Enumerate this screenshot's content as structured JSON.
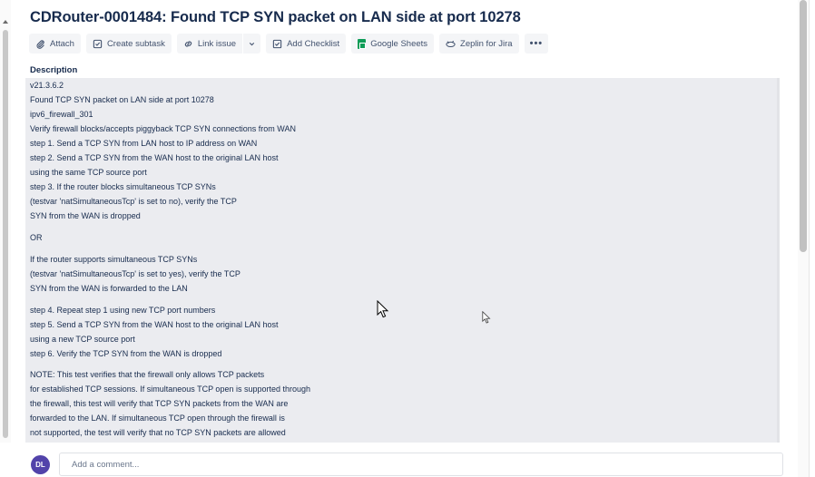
{
  "issue": {
    "title": "CDRouter-0001484: Found TCP SYN packet on LAN side at port 10278"
  },
  "toolbar": {
    "attach": "Attach",
    "create_subtask": "Create subtask",
    "link_issue": "Link issue",
    "add_checklist": "Add Checklist",
    "google_sheets": "Google Sheets",
    "zeplin": "Zeplin for Jira",
    "more": "•••"
  },
  "description": {
    "label": "Description",
    "paragraphs": [
      {
        "lines": [
          "v21.3.6.2",
          "Found TCP SYN packet on LAN side at port 10278",
          "ipv6_firewall_301",
          "Verify firewall blocks/accepts piggyback TCP SYN connections from WAN",
          "step 1. Send a TCP SYN from LAN host to IP address on WAN",
          "step 2. Send a TCP SYN from the WAN host to the original LAN host",
          "using the same TCP source port",
          "step 3. If the router blocks simultaneous TCP SYNs",
          "(testvar 'natSimultaneousTcp' is set to no), verify the TCP",
          "SYN from the WAN is dropped"
        ]
      },
      {
        "lines": [
          "OR"
        ]
      },
      {
        "lines": [
          "If the router supports simultaneous TCP SYNs",
          "(testvar 'natSimultaneousTcp' is set to yes), verify the TCP",
          "SYN from the WAN is forwarded to the LAN"
        ]
      },
      {
        "lines": [
          "step 4. Repeat step 1 using new TCP port numbers",
          "step 5. Send a TCP SYN from the WAN host to the original LAN host",
          "using a new TCP source port",
          "step 6. Verify the TCP SYN from the WAN is dropped"
        ]
      },
      {
        "lines": [
          "NOTE: This test verifies that the firewall only allows TCP packets",
          "for established TCP sessions. If simultaneous TCP open is supported through",
          "the firewall, this test will verify that TCP SYN packets from the WAN are",
          "forwarded to the LAN. If simultaneous TCP open through the firewall is",
          "not supported, the test will verify that no TCP SYN packets are allowed"
        ]
      }
    ]
  },
  "comment": {
    "avatar_initials": "DL",
    "placeholder": "Add a comment..."
  }
}
